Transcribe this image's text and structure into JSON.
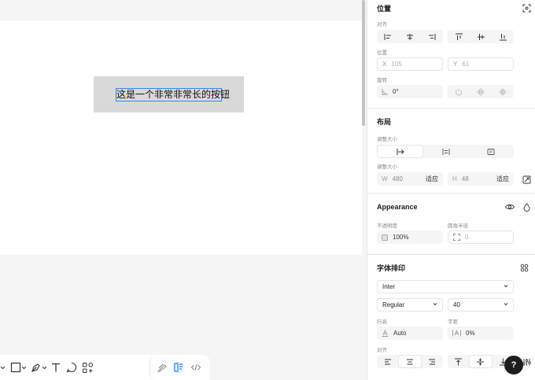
{
  "canvas": {
    "button_text": "这是一个非常非常长的按钮"
  },
  "toolbar": {
    "tools": [
      "frame-icon",
      "rectangle-icon",
      "pen-icon",
      "text-icon",
      "comment-icon",
      "components-icon"
    ],
    "modes": [
      "draw-mode-icon",
      "design-mode-icon",
      "dev-mode-icon"
    ]
  },
  "panel": {
    "position": {
      "title": "位置",
      "align_label": "对齐",
      "position_label": "位置",
      "x_prefix": "X",
      "x_value": "105",
      "y_prefix": "Y",
      "y_value": "61",
      "rotation_label": "旋转",
      "rotation_value": "0°"
    },
    "layout": {
      "title": "布局",
      "resize_label": "调整大小",
      "size_label": "调整大小",
      "w_prefix": "W",
      "w_value": "480",
      "w_mode": "适应",
      "h_prefix": "H",
      "h_value": "48",
      "h_mode": "适应"
    },
    "appearance": {
      "title": "Appearance",
      "opacity_label": "不透明度",
      "opacity_value": "100%",
      "radius_label": "圆角半径",
      "radius_value": "0"
    },
    "typography": {
      "title": "字体排印",
      "font_family": "Inter",
      "font_weight": "Regular",
      "font_size": "40",
      "line_height_label": "行高",
      "line_height_value": "Auto",
      "letter_spacing_label": "字距",
      "letter_spacing_value": "0%",
      "align_label": "对齐"
    },
    "help_label": "?"
  },
  "colors": {
    "accent": "#2f86f6",
    "selected_fill": "#d9d9d9"
  }
}
